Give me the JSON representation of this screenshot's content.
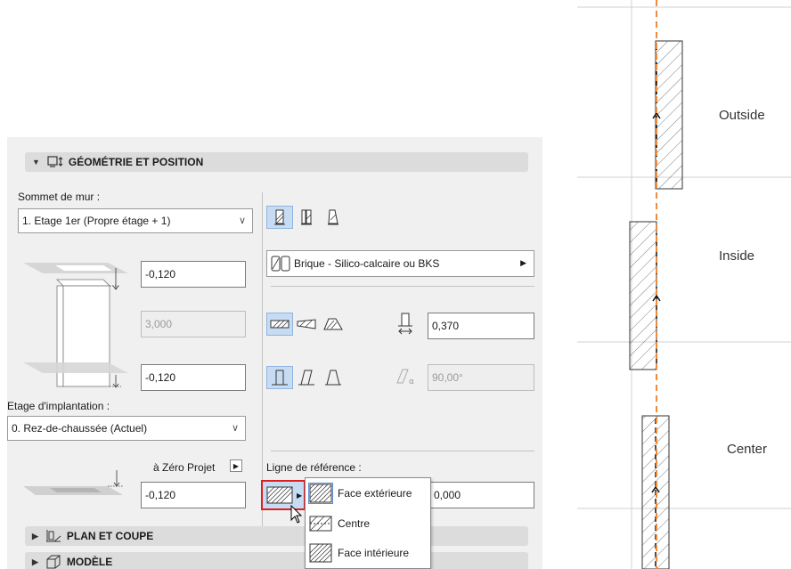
{
  "sections": {
    "geometry": {
      "title": "GÉOMÉTRIE ET POSITION",
      "expanded": true
    },
    "plan": {
      "title": "PLAN ET COUPE",
      "expanded": false
    },
    "model": {
      "title": "MODÈLE",
      "expanded": false
    }
  },
  "wall_top": {
    "label": "Sommet de mur :",
    "selected": "1. Etage 1er (Propre étage + 1)"
  },
  "offsets": {
    "top_offset": "-0,120",
    "height": "3,000",
    "bottom_offset": "-0,120"
  },
  "home_story": {
    "label": "Etage d'implantation :",
    "selected": "0. Rez-de-chaussée (Actuel)"
  },
  "project_zero": {
    "label": "à Zéro Projet",
    "value": "-0,120"
  },
  "material": {
    "label": "Brique - Silico-calcaire ou BKS"
  },
  "thickness": {
    "value": "0,370"
  },
  "angle": {
    "value": "90,00°"
  },
  "reference_line": {
    "label": "Ligne de référence :",
    "offset_value": "0,000",
    "options": [
      "Face extérieure",
      "Centre",
      "Face intérieure"
    ],
    "selected": "Face extérieure"
  },
  "diagram": {
    "labels": [
      "Outside",
      "Inside",
      "Center"
    ],
    "guide_color": "#f08a3c",
    "hatch_color": "#444444"
  },
  "colors": {
    "selected_bg": "#c7dcf3",
    "highlight_red": "#e02020"
  }
}
